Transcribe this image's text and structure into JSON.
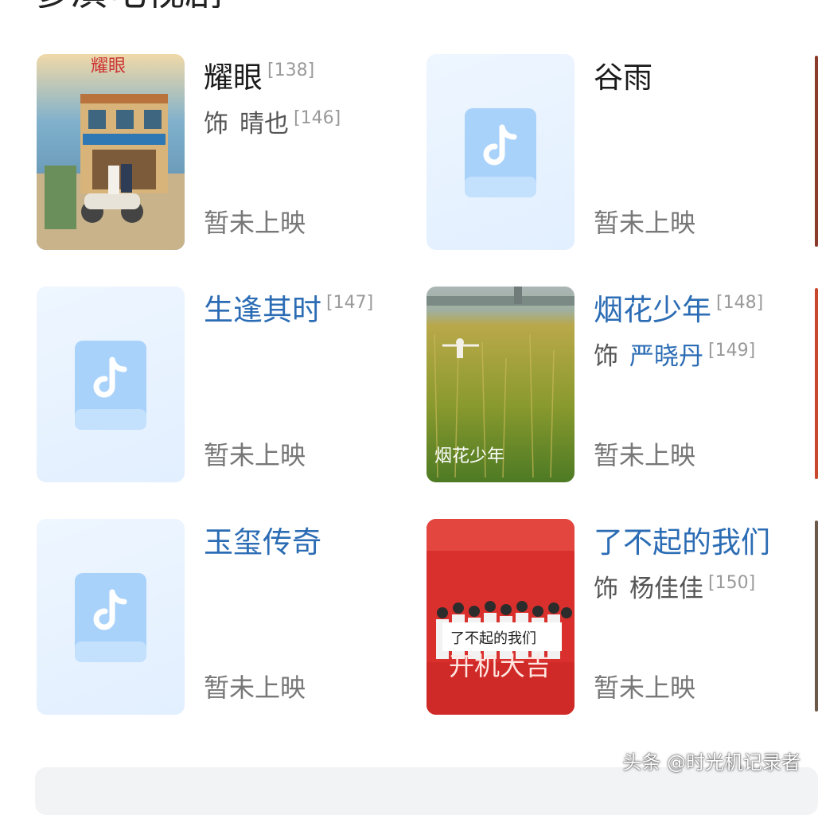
{
  "header_partial": "参演电视剧",
  "items": [
    {
      "title": "耀眼",
      "ref": "[138]",
      "role_prefix": "饰",
      "role": "晴也",
      "role_ref": "[146]",
      "status": "暂未上映",
      "poster_text": "耀眼"
    },
    {
      "title": "谷雨",
      "ref": "",
      "status": "暂未上映"
    },
    {
      "title": "生逢其时",
      "ref": "[147]",
      "status": "暂未上映"
    },
    {
      "title": "烟花少年",
      "ref": "[148]",
      "role_prefix": "饰",
      "role": "严晓丹",
      "role_ref": "[149]",
      "status": "暂未上映",
      "poster_text": "烟花少年"
    },
    {
      "title": "玉玺传奇",
      "ref": "",
      "status": "暂未上映"
    },
    {
      "title": "了不起的我们",
      "ref": "",
      "role_prefix": "饰",
      "role": "杨佳佳",
      "role_ref": "[150]",
      "status": "暂未上映",
      "poster_text": "了不起的我们",
      "poster_banner": "开机大吉"
    }
  ],
  "watermark": "头条 @时光机记录者",
  "colors": {
    "link": "#2b6cb4",
    "status": "#777777",
    "placeholder": "#e6f1ff",
    "icon": "#9cc8f7"
  },
  "icons": {
    "placeholder": "douyin-book-icon"
  }
}
